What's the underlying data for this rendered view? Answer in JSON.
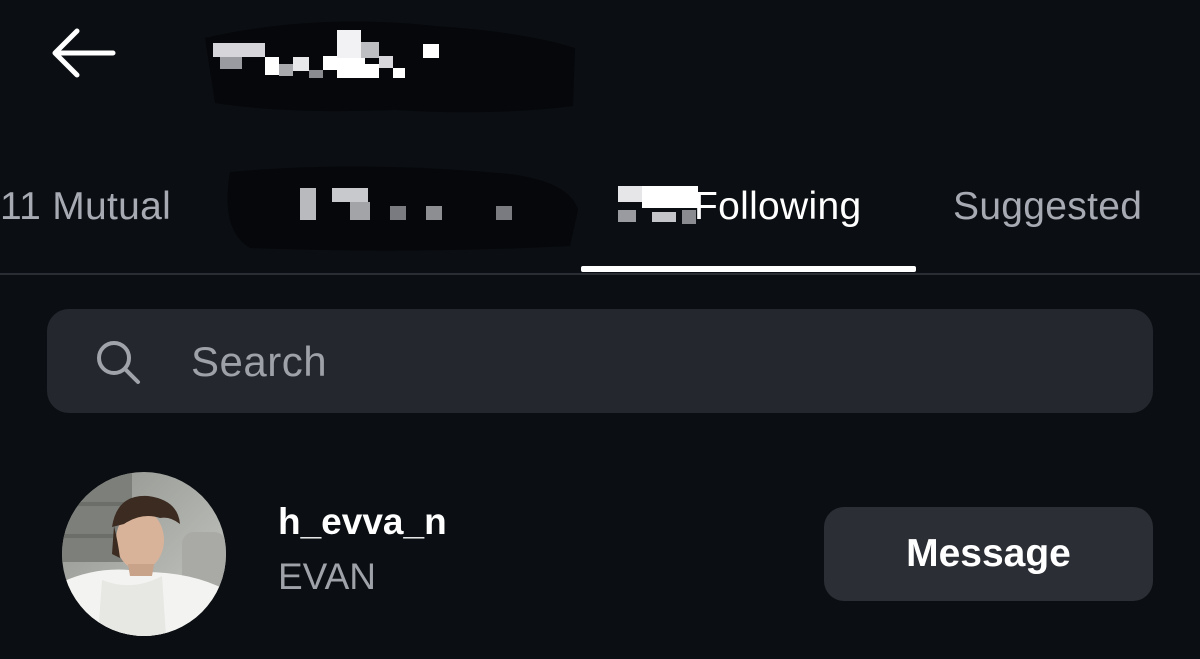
{
  "header": {
    "back_icon": "arrow-left-icon"
  },
  "tabs": [
    {
      "label": "11 Mutual",
      "active": false
    },
    {
      "label": "Following",
      "active": true
    },
    {
      "label": "Suggested",
      "active": false
    }
  ],
  "search": {
    "placeholder": "Search",
    "icon": "search-icon"
  },
  "users": [
    {
      "username": "h_evva_n",
      "display_name": "EVAN",
      "action_label": "Message"
    }
  ],
  "colors": {
    "background": "#0b0e12",
    "surface": "#24272d",
    "button": "#2b2e34",
    "muted_text": "#a7aab2",
    "active_text": "#ffffff"
  }
}
